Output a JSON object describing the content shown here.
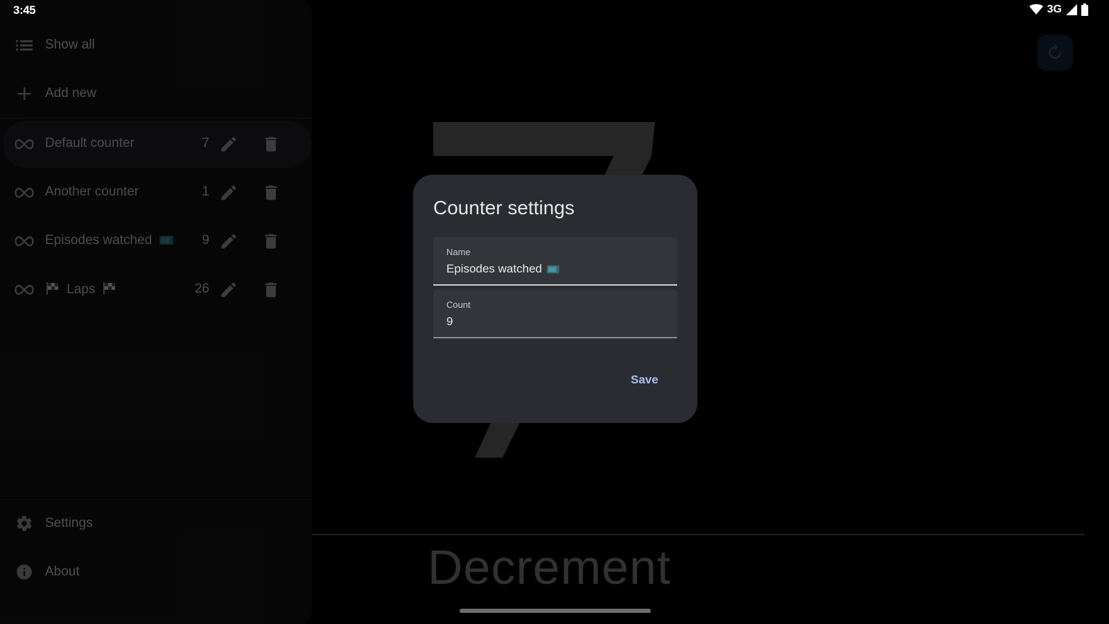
{
  "status_bar": {
    "time": "3:45",
    "network": "3G"
  },
  "drawer": {
    "show_all_label": "Show all",
    "add_new_label": "Add new",
    "counters": [
      {
        "name": "Default counter",
        "count": "7",
        "selected": true
      },
      {
        "name": "Another counter",
        "count": "1",
        "selected": false
      },
      {
        "name": "Episodes watched",
        "emoji": "tv-emoji",
        "count": "9",
        "selected": false
      },
      {
        "name": "Laps",
        "emoji": "checkered-flag-emoji",
        "count": "26",
        "selected": false
      }
    ],
    "settings_label": "Settings",
    "about_label": "About"
  },
  "main": {
    "current_value": "7",
    "decrement_label": "Decrement"
  },
  "dialog": {
    "title": "Counter settings",
    "name_label": "Name",
    "name_value": "Episodes watched",
    "count_label": "Count",
    "count_value": "9",
    "save_label": "Save"
  },
  "colors": {
    "background": "#000000",
    "drawer": "#0c0c0e",
    "dialog": "#2b2c31",
    "accent": "#aabdf0"
  }
}
